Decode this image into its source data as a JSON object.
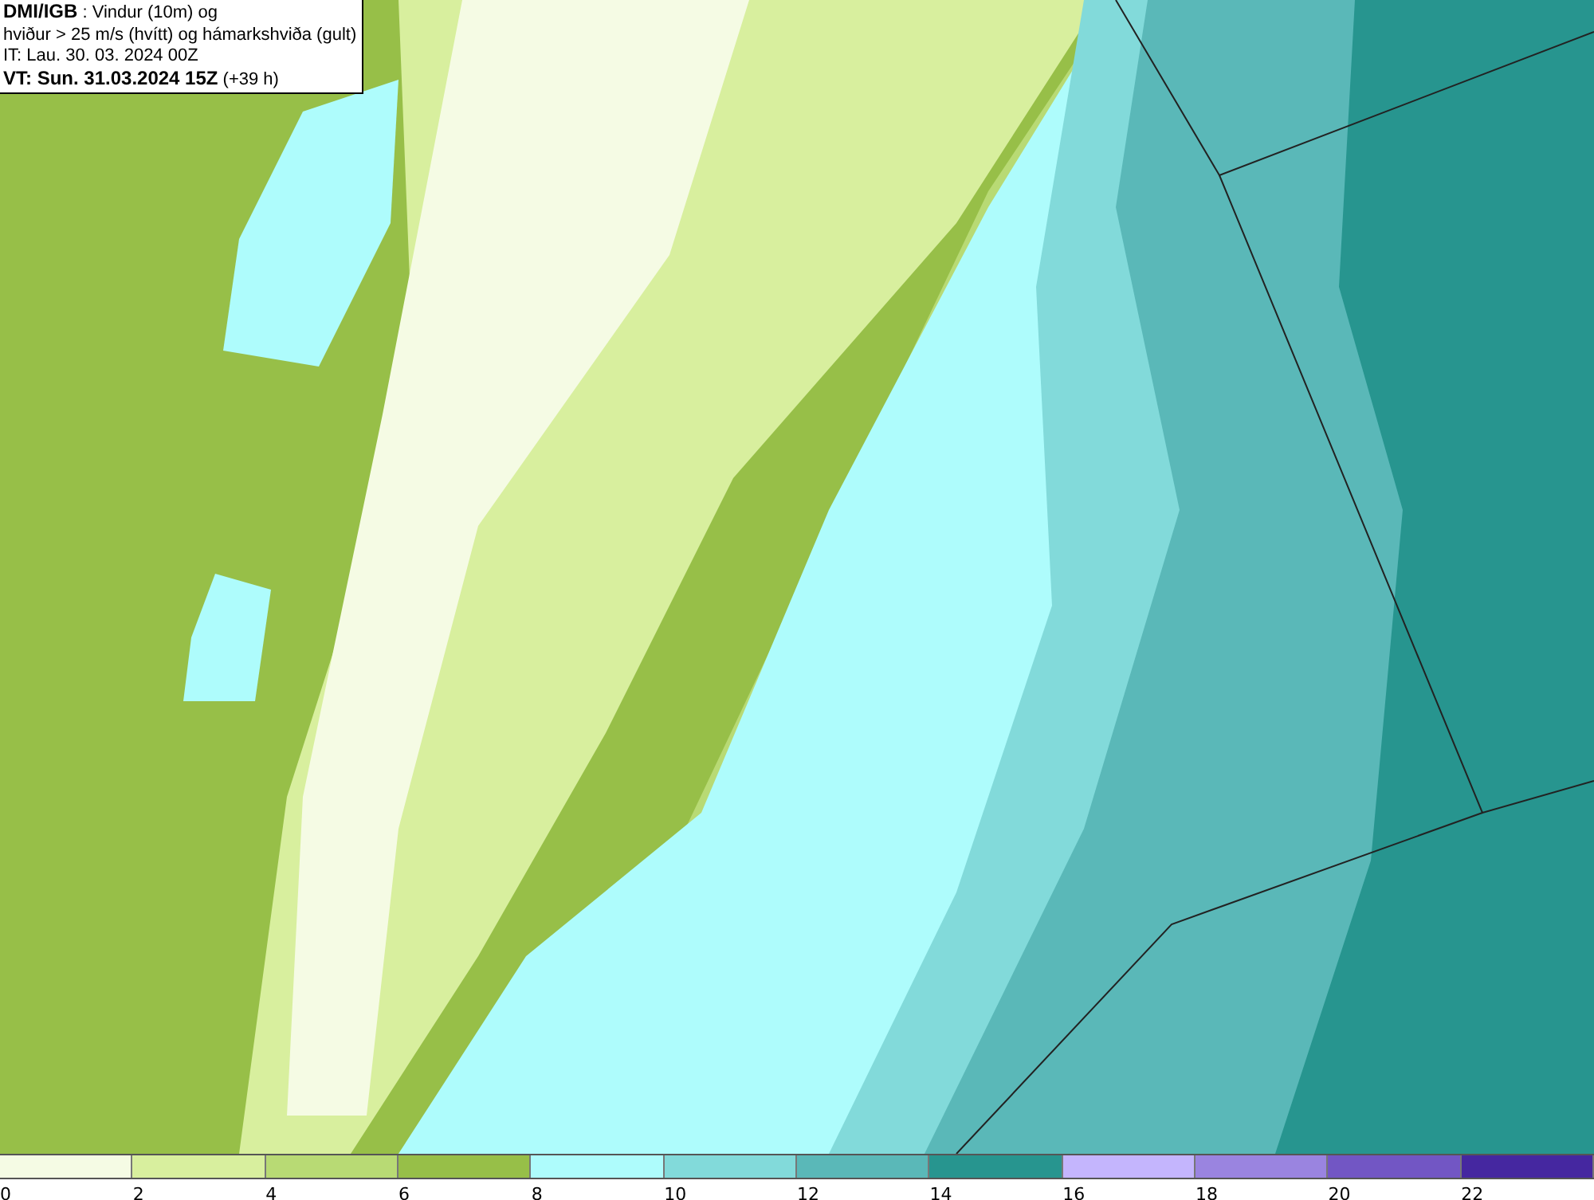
{
  "title_box": {
    "lines": [
      "**DMI/IGB** : Vindur (10m) og",
      "hviður > 25 m/s (hvítt) og hámarkshviða (gult)",
      "IT: Lau. 30. 03. 2024 00Z",
      "**VT: Sun. 31.03.2024 15Z** (+39 h)"
    ]
  },
  "legend": [
    {
      "label": "0",
      "color": "#f5fbe4"
    },
    {
      "label": "2",
      "color": "#d8ef9e"
    },
    {
      "label": "4",
      "color": "#b8da74"
    },
    {
      "label": "6",
      "color": "#97bf48"
    },
    {
      "label": "8",
      "color": "#aefcfc"
    },
    {
      "label": "10",
      "color": "#82dada"
    },
    {
      "label": "12",
      "color": "#5ab8b8"
    },
    {
      "label": "14",
      "color": "#27958f"
    },
    {
      "label": "16",
      "color": "#c4b5fd"
    },
    {
      "label": "18",
      "color": "#9a84e0"
    },
    {
      "label": "20",
      "color": "#7256c4"
    },
    {
      "label": "22",
      "color": "#4527a0"
    }
  ]
}
